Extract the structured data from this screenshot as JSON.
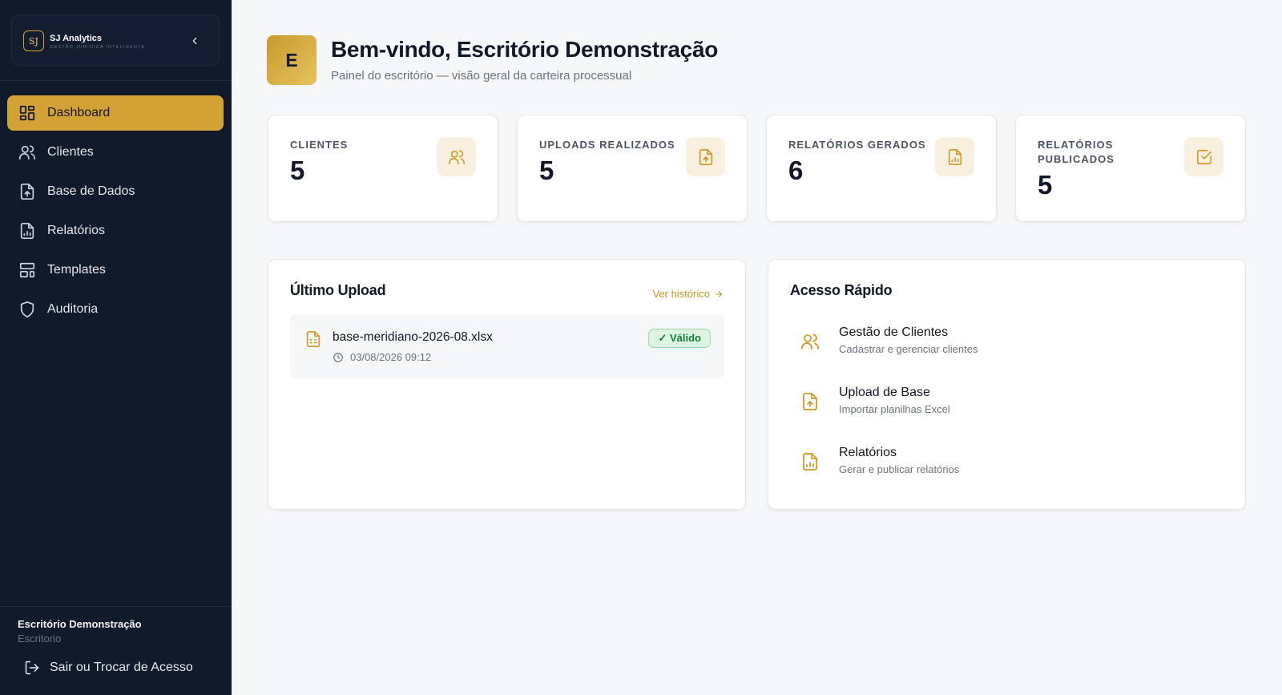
{
  "brand": {
    "logo_text": "SJ",
    "name": "SJ Analytics",
    "tagline": "GESTÃO JURÍDICA INTELIGENTE"
  },
  "sidebar": {
    "items": [
      {
        "label": "Dashboard",
        "icon": "dashboard-icon",
        "active": true
      },
      {
        "label": "Clientes",
        "icon": "users-icon"
      },
      {
        "label": "Base de Dados",
        "icon": "file-upload-icon"
      },
      {
        "label": "Relatórios",
        "icon": "file-chart-icon"
      },
      {
        "label": "Templates",
        "icon": "layout-icon"
      },
      {
        "label": "Auditoria",
        "icon": "shield-icon"
      }
    ],
    "office_name": "Escritório Demonstração",
    "office_role": "Escritorio",
    "logout_label": "Sair ou Trocar de Acesso"
  },
  "header": {
    "avatar_letter": "E",
    "title": "Bem-vindo, Escritório Demonstração",
    "subtitle": "Painel do escritório — visão geral da carteira processual"
  },
  "stats": [
    {
      "label": "CLIENTES",
      "value": "5",
      "icon": "users-icon"
    },
    {
      "label": "UPLOADS REALIZADOS",
      "value": "5",
      "icon": "file-upload-icon"
    },
    {
      "label": "RELATÓRIOS GERADOS",
      "value": "6",
      "icon": "file-chart-icon"
    },
    {
      "label": "RELATÓRIOS PUBLICADOS",
      "value": "5",
      "icon": "check-square-icon"
    }
  ],
  "last_upload": {
    "title": "Último Upload",
    "history_link": "Ver histórico",
    "file_name": "base-meridiano-2026-08.xlsx",
    "date": "03/08/2026 09:12",
    "status": "✓ Válido"
  },
  "quick_access": {
    "title": "Acesso Rápido",
    "items": [
      {
        "title": "Gestão de Clientes",
        "desc": "Cadastrar e gerenciar clientes",
        "icon": "users-icon"
      },
      {
        "title": "Upload de Base",
        "desc": "Importar planilhas Excel",
        "icon": "file-upload-icon"
      },
      {
        "title": "Relatórios",
        "desc": "Gerar e publicar relatórios",
        "icon": "file-chart-icon"
      }
    ]
  },
  "colors": {
    "accent": "#d4a234",
    "sidebar_bg": "#111a2b",
    "page_bg": "#f6f7f9",
    "success": "#15803d"
  }
}
